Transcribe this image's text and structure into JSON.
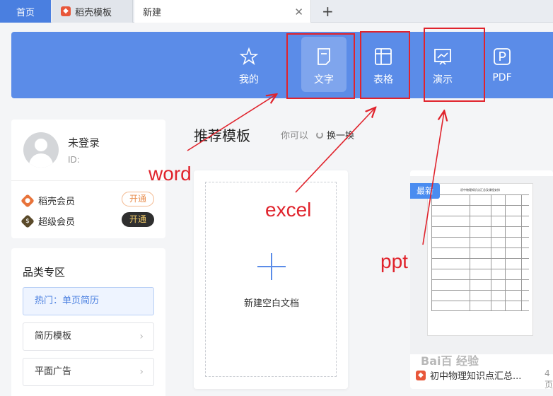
{
  "tabs": {
    "home": "首页",
    "daoke": "稻壳模板",
    "new": "新建",
    "close_icon": "close-icon",
    "plus_icon": "plus-icon"
  },
  "toolbar": {
    "items": [
      {
        "label": "我的",
        "icon": "star-icon"
      },
      {
        "label": "文字",
        "icon": "document-icon"
      },
      {
        "label": "表格",
        "icon": "table-icon"
      },
      {
        "label": "演示",
        "icon": "presentation-icon"
      },
      {
        "label": "PDF",
        "icon": "pdf-icon"
      }
    ],
    "color": "#5b8ce8"
  },
  "profile": {
    "name": "未登录",
    "id_label": "ID:",
    "members": [
      {
        "label": "稻壳会员",
        "button": "开通",
        "color": "#e8733a"
      },
      {
        "label": "超级会员",
        "button": "开通",
        "color": "#5a4a2a"
      }
    ]
  },
  "category": {
    "title": "品类专区",
    "items": [
      "热门：单页简历",
      "简历模板",
      "平面广告"
    ]
  },
  "recommend": {
    "title": "推荐模板",
    "hint": "你可以",
    "swap": "换一换",
    "blank_label": "新建空白文档",
    "template_badge": "最新",
    "template_name": "初中物理知识点汇总...",
    "template_pages": "4页",
    "template_doc_title": "初中物理知识点汇总及课程安排"
  },
  "annotations": {
    "word": "word",
    "excel": "excel",
    "ppt": "ppt",
    "color": "#e0232c"
  },
  "watermark": "Bai百 经验"
}
